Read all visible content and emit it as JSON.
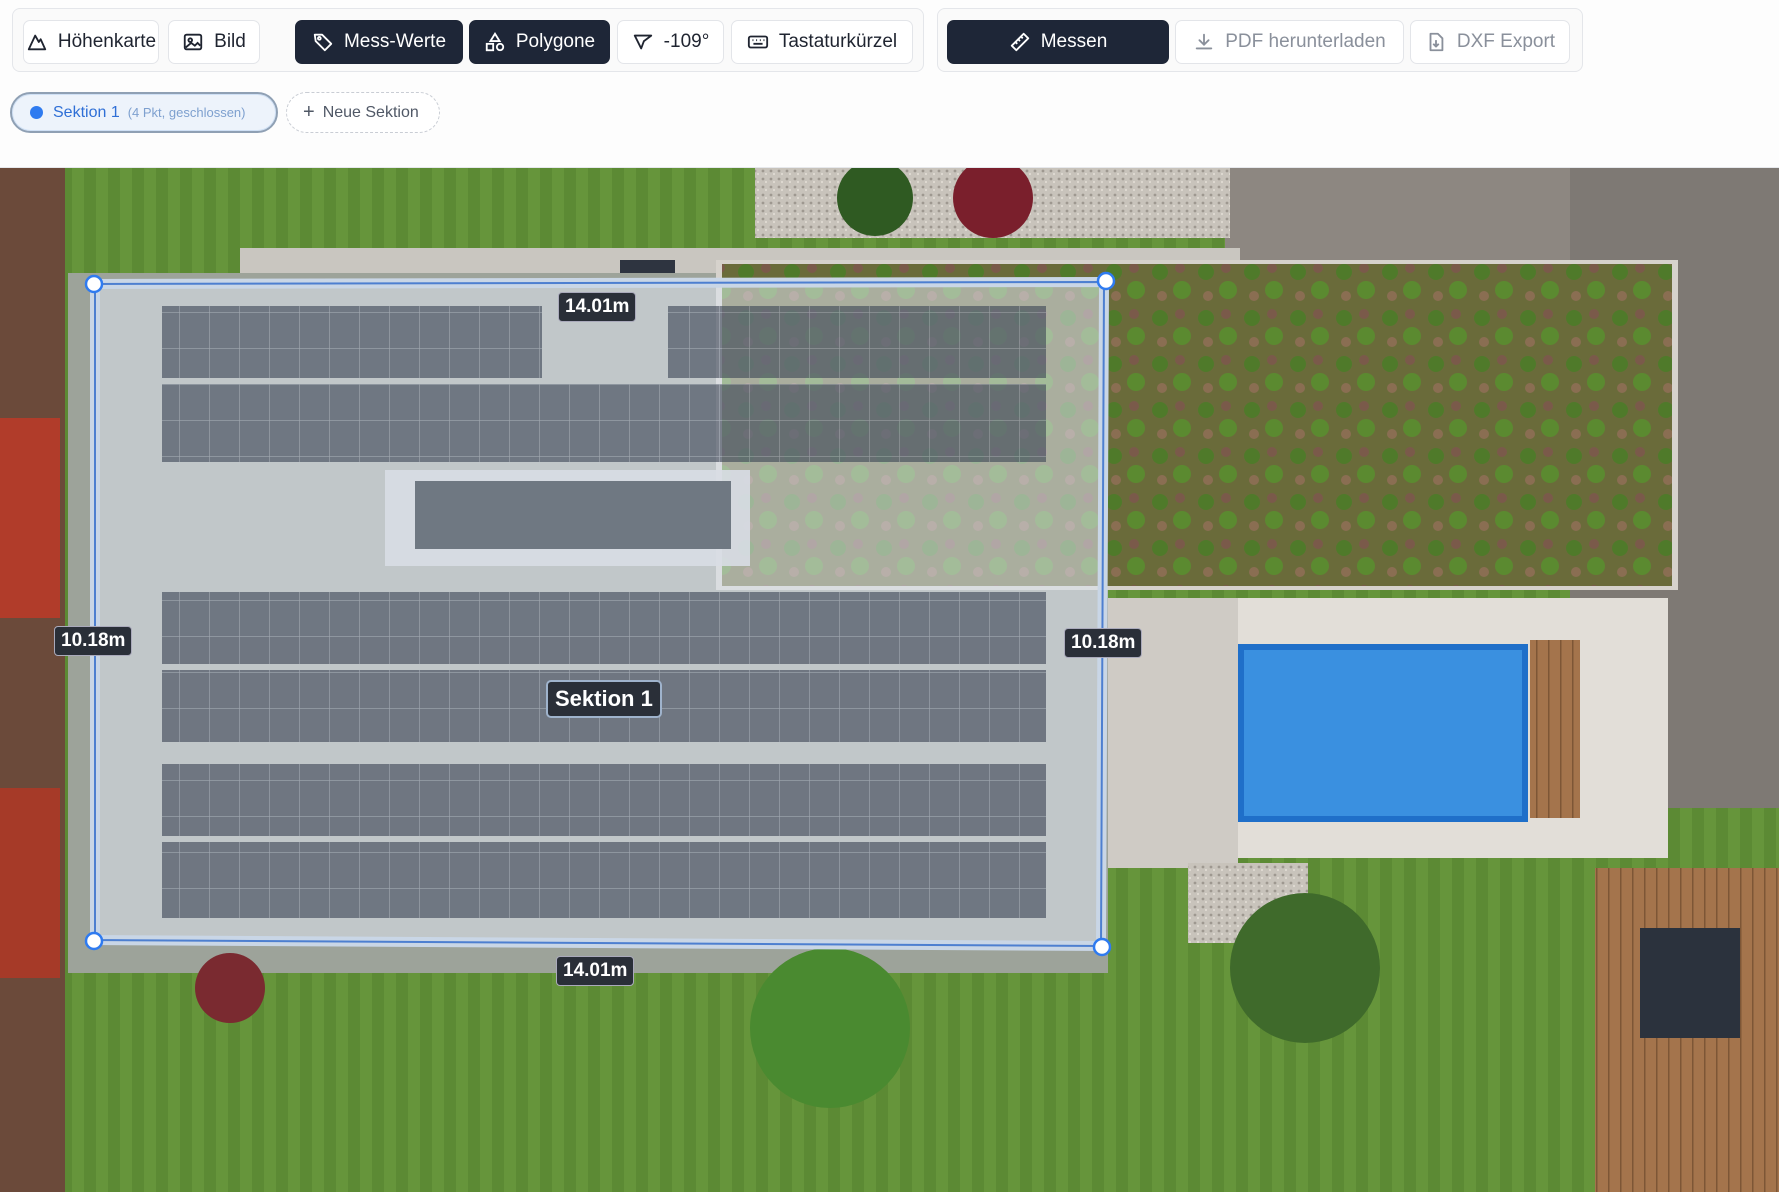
{
  "toolbar": {
    "view_buttons": [
      {
        "label": "Höhenkarte",
        "icon": "mountain-icon"
      },
      {
        "label": "Bild",
        "icon": "image-icon"
      },
      {
        "label": "Mess-Werte",
        "icon": "tag-icon",
        "active": true
      },
      {
        "label": "Polygone",
        "icon": "shapes-icon",
        "active": true
      },
      {
        "label": "-109°",
        "icon": "compass-arrow-icon"
      },
      {
        "label": "Tastaturkürzel",
        "icon": "keyboard-icon"
      }
    ],
    "actions": [
      {
        "label": "Messen",
        "icon": "ruler-icon",
        "active": true
      },
      {
        "label": "PDF herunterladen",
        "icon": "download-icon",
        "disabled": true
      },
      {
        "label": "DXF Export",
        "icon": "file-export-icon",
        "disabled": true
      }
    ]
  },
  "sections": {
    "active": {
      "name": "Sektion 1",
      "detail": "(4 Pkt, geschlossen)"
    },
    "add_label": "Neue Sektion"
  },
  "map": {
    "polygon_label": "Sektion 1",
    "edges": {
      "top": "14.01m",
      "bottom": "14.01m",
      "left": "10.18m",
      "right": "10.18m"
    }
  },
  "colors": {
    "accent_dark": "#1e2637",
    "selection_blue": "#2f7bf0",
    "polygon_fill": "#dfe6f0"
  }
}
